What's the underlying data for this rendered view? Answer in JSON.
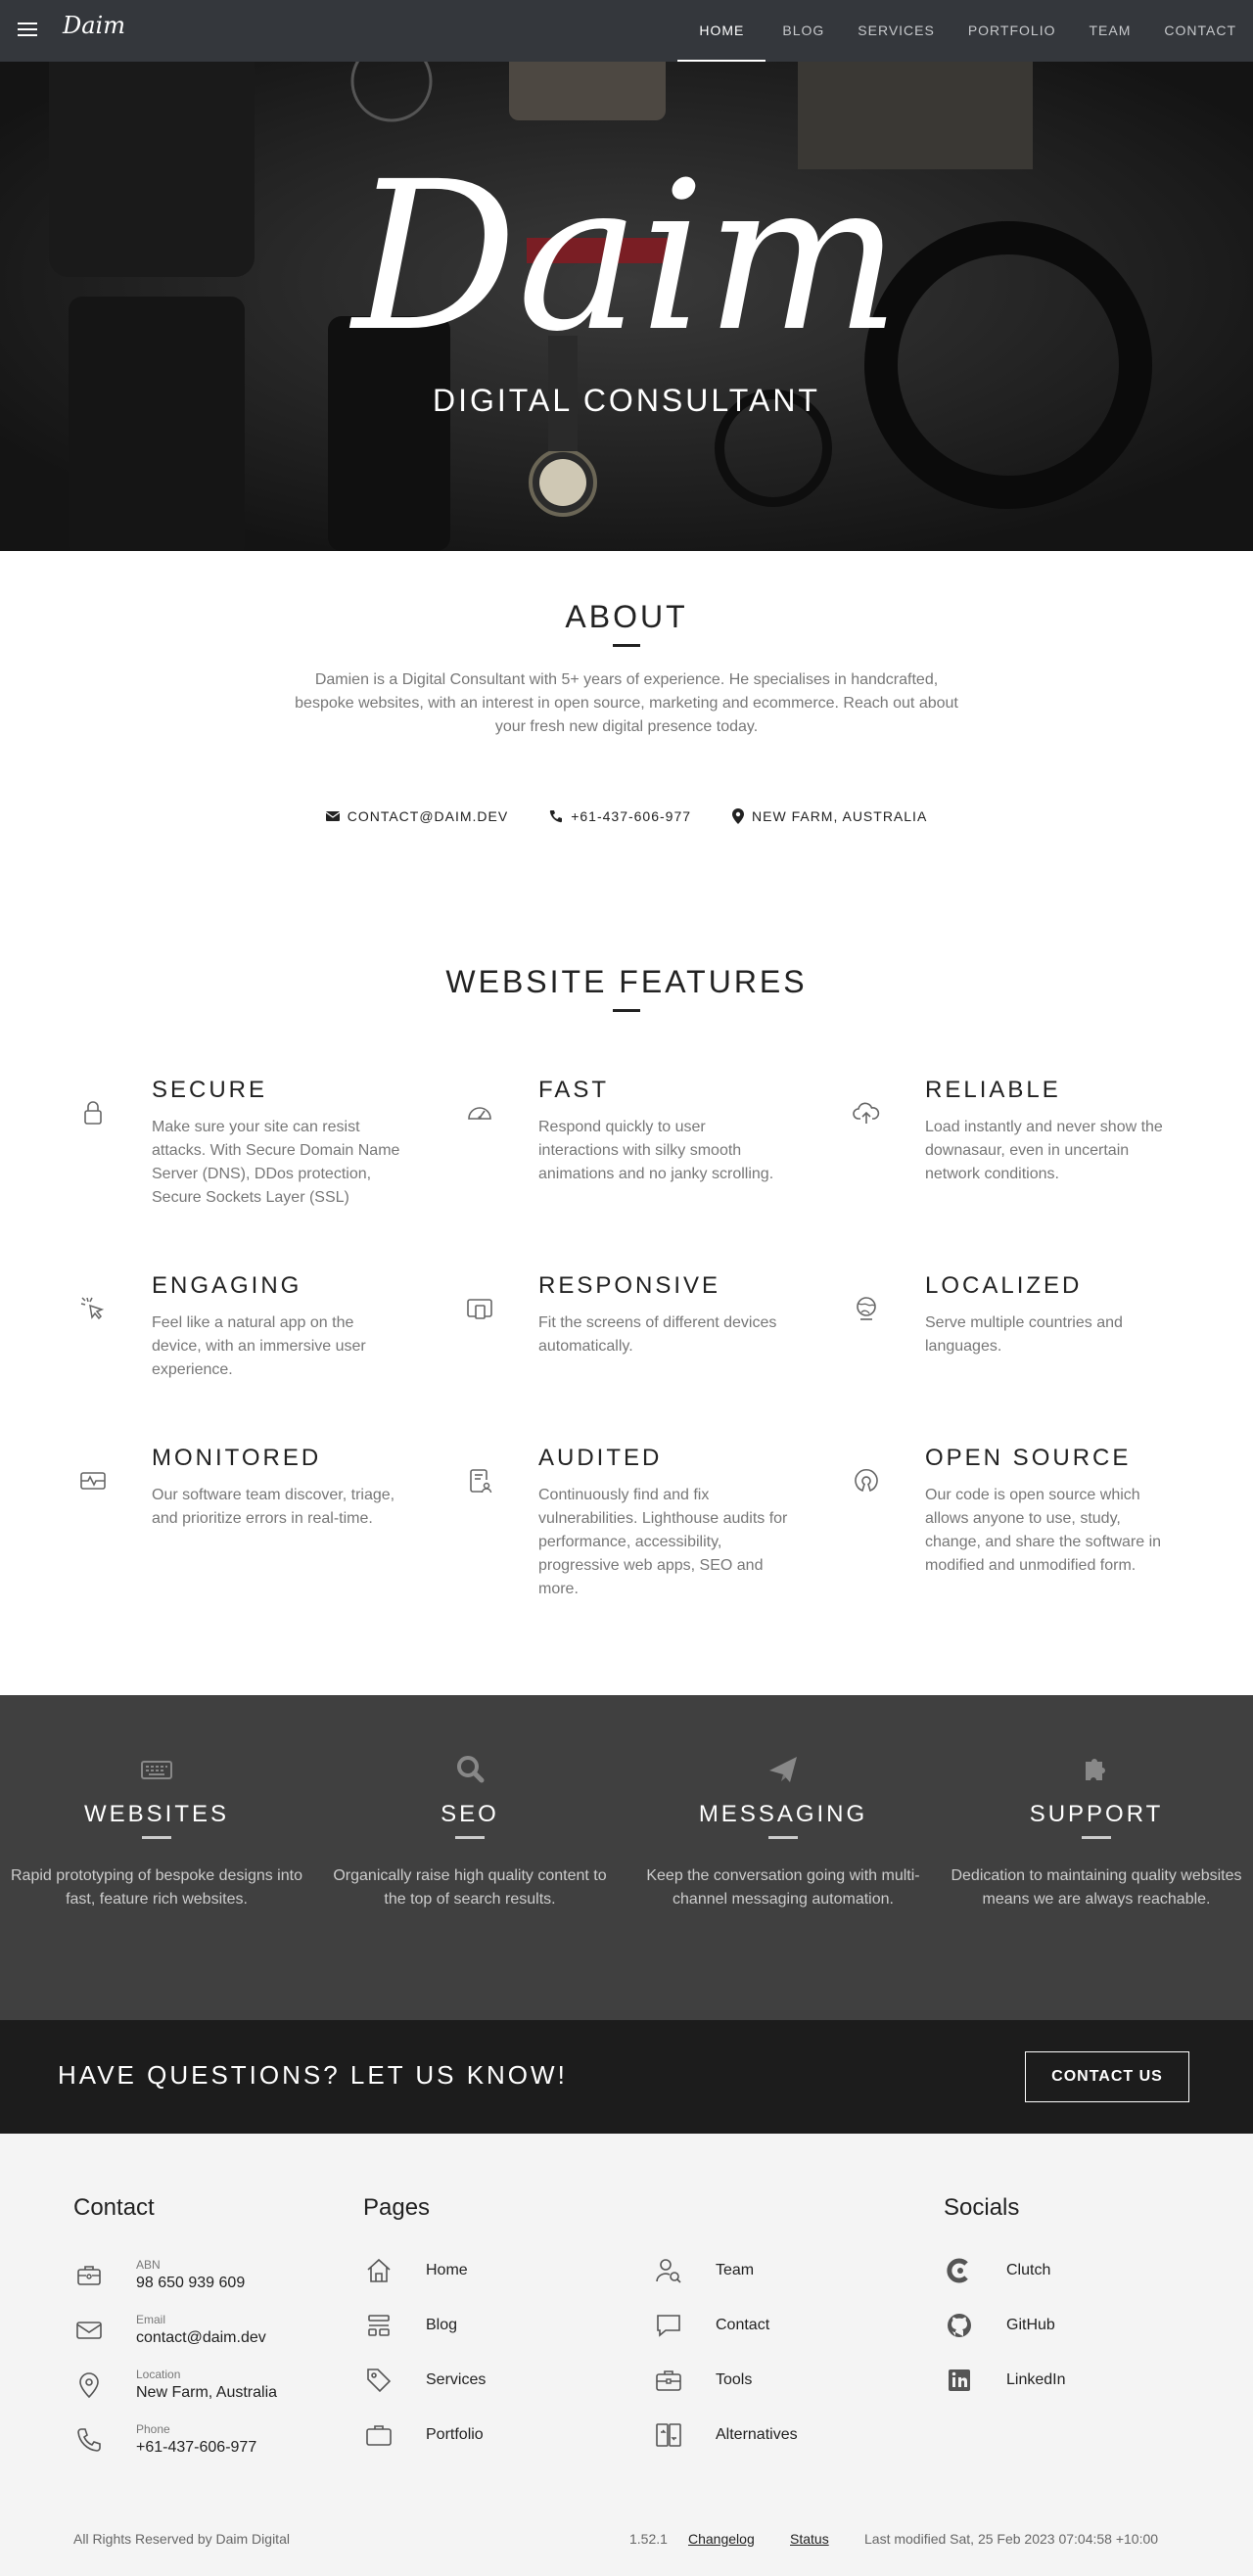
{
  "nav": {
    "logo": "Daim",
    "links": [
      "HOME",
      "BLOG",
      "SERVICES",
      "PORTFOLIO",
      "TEAM",
      "CONTACT"
    ],
    "active": "HOME"
  },
  "hero": {
    "title": "Daim",
    "subtitle": "DIGITAL CONSULTANT"
  },
  "about": {
    "title": "ABOUT",
    "text": "Damien is a Digital Consultant with 5+ years of experience. He specialises in handcrafted, bespoke websites, with an interest in open source, marketing and ecommerce. Reach out about your fresh new digital presence today.",
    "email": "CONTACT@DAIM.DEV",
    "phone": "+61-437-606-977",
    "location": "NEW FARM, AUSTRALIA"
  },
  "features": {
    "title": "WEBSITE FEATURES",
    "items": [
      {
        "title": "SECURE",
        "text": "Make sure your site can resist attacks. With Secure Domain Name Server (DNS), DDos protection, Secure Sockets Layer (SSL)",
        "icon": "lock-icon"
      },
      {
        "title": "FAST",
        "text": "Respond quickly to user interactions with silky smooth animations and no janky scrolling.",
        "icon": "speedometer-icon"
      },
      {
        "title": "RELIABLE",
        "text": "Load instantly and never show the downasaur, even in uncertain network conditions.",
        "icon": "cloud-upload-icon"
      },
      {
        "title": "ENGAGING",
        "text": "Feel like a natural app on the device, with an immersive user experience.",
        "icon": "cursor-click-icon"
      },
      {
        "title": "RESPONSIVE",
        "text": "Fit the screens of different devices automatically.",
        "icon": "devices-icon"
      },
      {
        "title": "LOCALIZED",
        "text": "Serve multiple countries and languages.",
        "icon": "globe-icon"
      },
      {
        "title": "MONITORED",
        "text": "Our software team discover, triage, and prioritize errors in real-time.",
        "icon": "monitor-pulse-icon"
      },
      {
        "title": "AUDITED",
        "text": "Continuously find and fix vulnerabilities. Lighthouse audits for performance, accessibility, progressive web apps, SEO and more.",
        "icon": "report-user-icon"
      },
      {
        "title": "OPEN SOURCE",
        "text": "Our code is open source which allows anyone to use, study, change, and share the software in modified and unmodified form.",
        "icon": "open-source-icon"
      }
    ]
  },
  "services": [
    {
      "title": "WEBSITES",
      "text": "Rapid prototyping of bespoke designs into fast, feature rich websites.",
      "icon": "keyboard-icon"
    },
    {
      "title": "SEO",
      "text": "Organically raise high quality content to the top of search results.",
      "icon": "search-icon"
    },
    {
      "title": "MESSAGING",
      "text": "Keep the conversation going with multi-channel messaging automation.",
      "icon": "paper-plane-icon"
    },
    {
      "title": "SUPPORT",
      "text": "Dedication to maintaining quality websites means we are always reachable.",
      "icon": "puzzle-icon"
    }
  ],
  "cta": {
    "question": "HAVE QUESTIONS? LET US KNOW!",
    "button": "CONTACT US"
  },
  "footer": {
    "contact_title": "Contact",
    "pages_title": "Pages",
    "socials_title": "Socials",
    "contact": [
      {
        "label": "ABN",
        "value": "98 650 939 609",
        "icon": "briefcase-id-icon"
      },
      {
        "label": "Email",
        "value": "contact@daim.dev",
        "icon": "mail-icon"
      },
      {
        "label": "Location",
        "value": "New Farm, Australia",
        "icon": "map-pin-icon"
      },
      {
        "label": "Phone",
        "value": "+61-437-606-977",
        "icon": "phone-icon"
      }
    ],
    "pages_col1": [
      {
        "label": "Home",
        "icon": "home-icon"
      },
      {
        "label": "Blog",
        "icon": "layout-icon"
      },
      {
        "label": "Services",
        "icon": "tag-icon"
      },
      {
        "label": "Portfolio",
        "icon": "briefcase-icon"
      }
    ],
    "pages_col2": [
      {
        "label": "Team",
        "icon": "user-search-icon"
      },
      {
        "label": "Contact",
        "icon": "message-icon"
      },
      {
        "label": "Tools",
        "icon": "toolbox-icon"
      },
      {
        "label": "Alternatives",
        "icon": "switch-icon"
      }
    ],
    "socials": [
      {
        "label": "Clutch",
        "icon": "clutch-icon"
      },
      {
        "label": "GitHub",
        "icon": "github-icon"
      },
      {
        "label": "LinkedIn",
        "icon": "linkedin-icon"
      }
    ],
    "copyright": "All Rights Reserved by Daim Digital",
    "version": "1.52.1",
    "changelog": "Changelog",
    "status": "Status",
    "modified": "Last modified Sat, 25 Feb 2023 07:04:58 +10:00"
  }
}
